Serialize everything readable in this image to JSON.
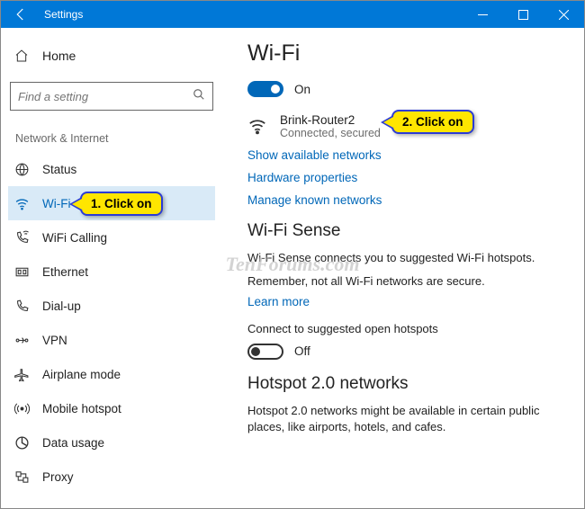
{
  "titlebar": {
    "title": "Settings"
  },
  "sidebar": {
    "home_label": "Home",
    "search_placeholder": "Find a setting",
    "group_label": "Network & Internet",
    "items": [
      {
        "label": "Status"
      },
      {
        "label": "Wi-Fi"
      },
      {
        "label": "WiFi Calling"
      },
      {
        "label": "Ethernet"
      },
      {
        "label": "Dial-up"
      },
      {
        "label": "VPN"
      },
      {
        "label": "Airplane mode"
      },
      {
        "label": "Mobile hotspot"
      },
      {
        "label": "Data usage"
      },
      {
        "label": "Proxy"
      }
    ]
  },
  "content": {
    "title": "Wi-Fi",
    "wifi_toggle_label": "On",
    "network": {
      "name": "Brink-Router2",
      "status": "Connected, secured"
    },
    "link_show_available": "Show available networks",
    "link_hardware_props": "Hardware properties",
    "link_manage_known": "Manage known networks",
    "sense_title": "Wi-Fi Sense",
    "sense_desc": "Wi-Fi Sense connects you to suggested Wi-Fi hotspots.",
    "sense_remember": "Remember, not all Wi-Fi networks are secure.",
    "link_learn_more": "Learn more",
    "sense_connect_label": "Connect to suggested open hotspots",
    "sense_toggle_label": "Off",
    "hotspot_title": "Hotspot 2.0 networks",
    "hotspot_desc": "Hotspot 2.0 networks might be available in certain public places, like airports, hotels, and cafes."
  },
  "callouts": {
    "c1": "1. Click on",
    "c2": "2. Click on"
  },
  "watermark": "TenForums.com"
}
